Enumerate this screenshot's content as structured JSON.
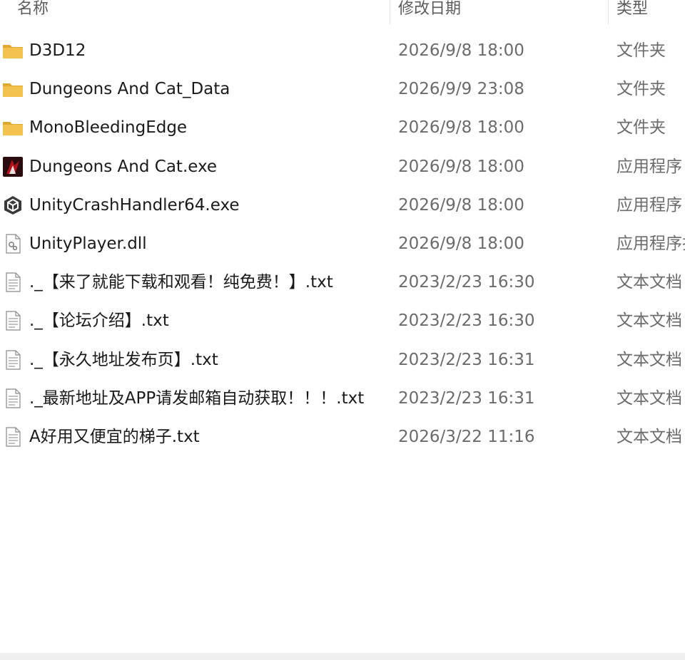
{
  "columns": {
    "name": "名称",
    "date": "修改日期",
    "type": "类型"
  },
  "files": [
    {
      "name": "D3D12",
      "date": "2026/9/8 18:00",
      "type": "文件夹",
      "icon": "folder-icon"
    },
    {
      "name": "Dungeons And Cat_Data",
      "date": "2026/9/9 23:08",
      "type": "文件夹",
      "icon": "folder-icon"
    },
    {
      "name": "MonoBleedingEdge",
      "date": "2026/9/8 18:00",
      "type": "文件夹",
      "icon": "folder-icon"
    },
    {
      "name": "Dungeons And Cat.exe",
      "date": "2026/9/8 18:00",
      "type": "应用程序",
      "icon": "game-app-icon"
    },
    {
      "name": "UnityCrashHandler64.exe",
      "date": "2026/9/8 18:00",
      "type": "应用程序",
      "icon": "unity-icon"
    },
    {
      "name": "UnityPlayer.dll",
      "date": "2026/9/8 18:00",
      "type": "应用程序扩",
      "icon": "dll-file-icon"
    },
    {
      "name": "._【来了就能下载和观看！纯免费！】.txt",
      "date": "2023/2/23 16:30",
      "type": "文本文档",
      "icon": "text-file-icon"
    },
    {
      "name": "._【论坛介绍】.txt",
      "date": "2023/2/23 16:30",
      "type": "文本文档",
      "icon": "text-file-icon"
    },
    {
      "name": "._【永久地址发布页】.txt",
      "date": "2023/2/23 16:31",
      "type": "文本文档",
      "icon": "text-file-icon"
    },
    {
      "name": "._最新地址及APP请发邮箱自动获取！！！.txt",
      "date": "2023/2/23 16:31",
      "type": "文本文档",
      "icon": "text-file-icon"
    },
    {
      "name": "A好用又便宜的梯子.txt",
      "date": "2026/3/22 11:16",
      "type": "文本文档",
      "icon": "text-file-icon"
    }
  ],
  "colors": {
    "folder": "#f2c14e",
    "folder_dark": "#e0a82e",
    "accent_red": "#b3121b"
  }
}
